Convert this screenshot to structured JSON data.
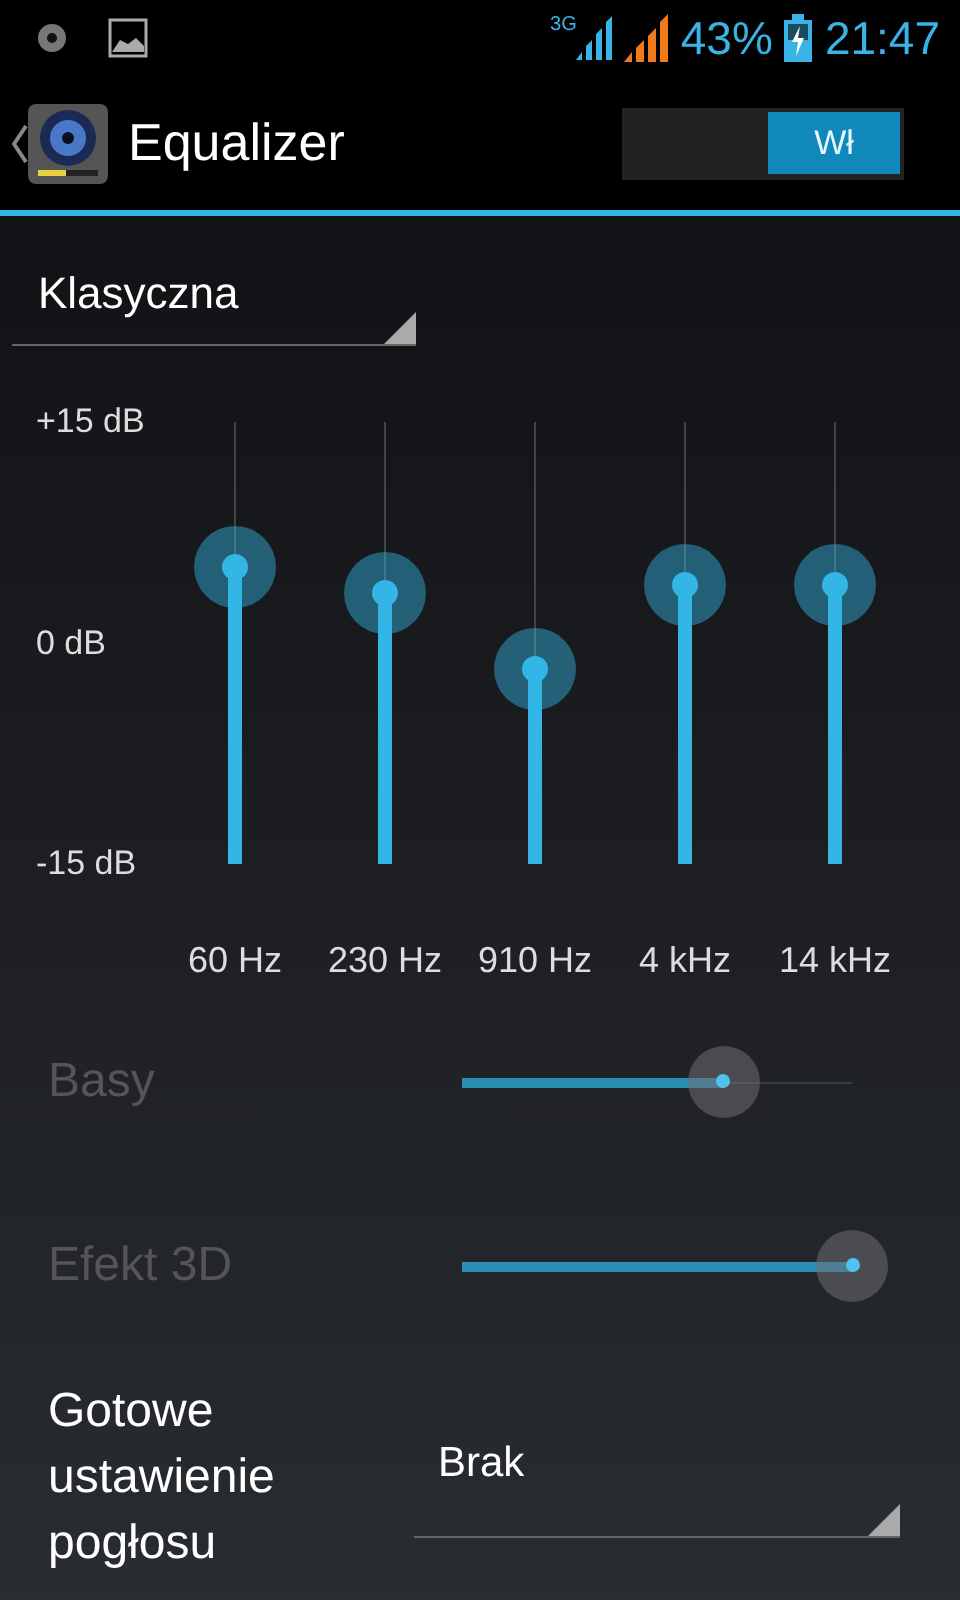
{
  "status_bar": {
    "network": "3G",
    "battery": "43%",
    "time": "21:47"
  },
  "action_bar": {
    "title": "Equalizer",
    "switch": {
      "label": "Wł",
      "on": true
    }
  },
  "preset_spinner": {
    "value": "Klasyczna"
  },
  "equalizer": {
    "scale": [
      "+15 dB",
      "0 dB",
      "-15 dB"
    ],
    "bands": [
      {
        "label": "60 Hz",
        "level": 0.67
      },
      {
        "label": "230 Hz",
        "level": 0.61
      },
      {
        "label": "910 Hz",
        "level": 0.44
      },
      {
        "label": "4 kHz",
        "level": 0.63
      },
      {
        "label": "14 kHz",
        "level": 0.63
      }
    ]
  },
  "effects": [
    {
      "label": "Basy",
      "disabled": true,
      "level": 0.67
    },
    {
      "label": "Efekt 3D",
      "disabled": true,
      "level": 1.0
    }
  ],
  "reverb": {
    "label": "Gotowe ustawienie pogłosu",
    "value": "Brak"
  }
}
